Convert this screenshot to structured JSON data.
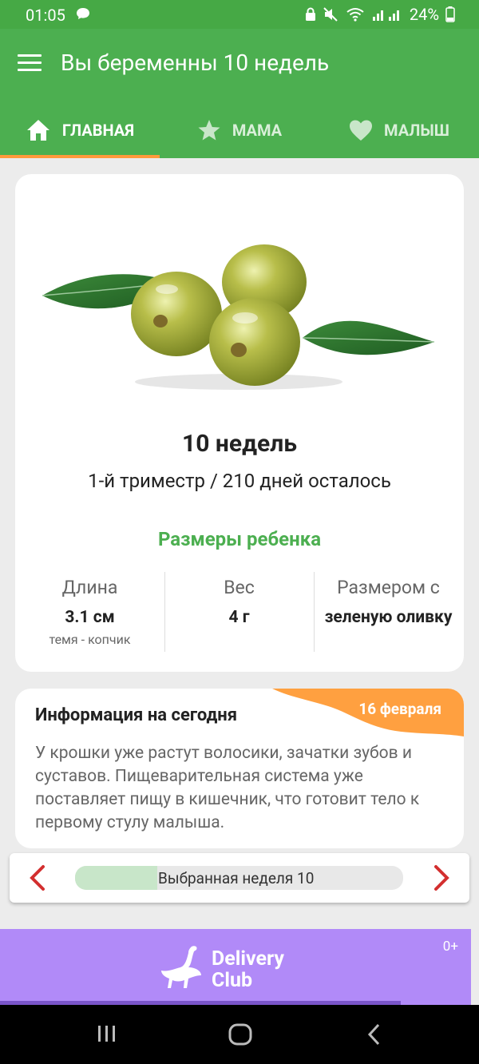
{
  "status": {
    "time": "01:05",
    "battery": "24%"
  },
  "appbar": {
    "title": "Вы беременны 10 недель"
  },
  "tabs": [
    {
      "label": "ГЛАВНАЯ",
      "icon": "home-icon"
    },
    {
      "label": "МАМА",
      "icon": "star-icon"
    },
    {
      "label": "МАЛЫШ",
      "icon": "heart-icon"
    }
  ],
  "card": {
    "weeks": "10 недель",
    "trimester": "1-й триместр / 210 дней осталось",
    "sizes_title": "Размеры ребенка",
    "columns": [
      {
        "label": "Длина",
        "value": "3.1 см",
        "sub": "темя - копчик"
      },
      {
        "label": "Вес",
        "value": "4 г",
        "sub": ""
      },
      {
        "label": "Размером с",
        "value": "зеленую оливку",
        "sub": ""
      }
    ]
  },
  "info": {
    "title": "Информация на сегодня",
    "date": "16 февраля",
    "text": "У крошки уже растут волосики, зачатки зубов и суставов. Пищеварительная система уже поставляет пищу в кишечник, что готовит тело к первому стулу малыша."
  },
  "week_selector": {
    "label": "Выбранная неделя 10",
    "progress_fraction": 0.25
  },
  "ad": {
    "brand_line1": "Delivery",
    "brand_line2": "Club",
    "age": "0+"
  },
  "colors": {
    "primary": "#4caf50",
    "accent": "#ff9a3c",
    "ad_bg": "#b18af8",
    "arrow": "#d32f2f"
  }
}
